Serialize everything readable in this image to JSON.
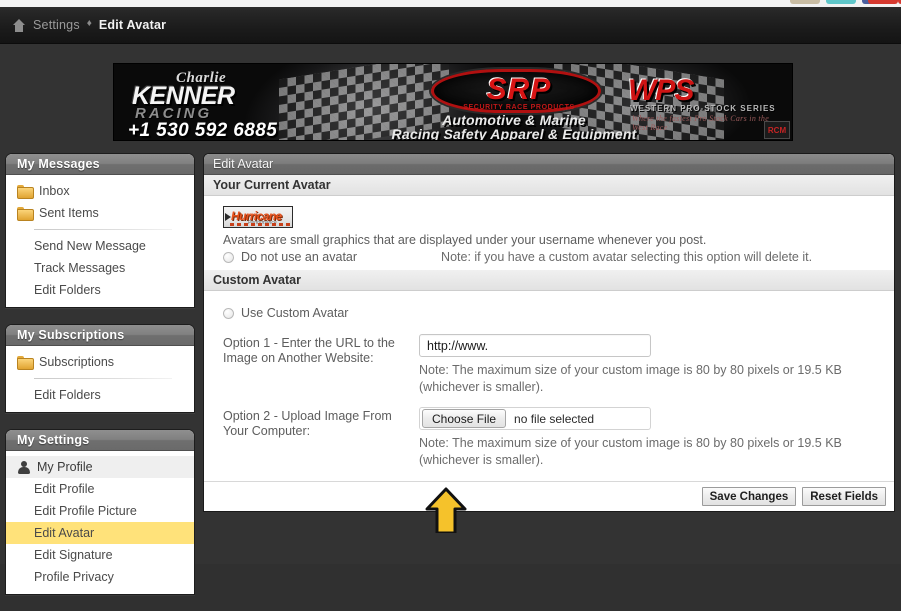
{
  "breadcrumb": {
    "home_icon": "home-icon",
    "parent": "Settings",
    "separator": "♦",
    "current": "Edit Avatar"
  },
  "banner": {
    "kenner": {
      "script": "Charlie",
      "main": "KENNER",
      "racing": "RACING",
      "phone": "+1 530 592 6885"
    },
    "srp": {
      "acronym": "SRP",
      "sub": "SECURITY RACE PRODUCTS",
      "line1": "Automotive & Marine",
      "line2": "Racing Safety Apparel & Equipment"
    },
    "wps": {
      "acronym": "WPS",
      "sub": "WESTERN PRO-STOCK SERIES",
      "sub2": "Where the fastest Pro Stock Cars in the West Race",
      "badge": "RCM"
    }
  },
  "sidebar": {
    "panels": [
      {
        "title": "My Messages",
        "items": [
          {
            "label": "Inbox",
            "icon": "folder-icon",
            "type": "folder"
          },
          {
            "label": "Sent Items",
            "icon": "folder-icon",
            "type": "folder"
          },
          {
            "label": "divider",
            "type": "divider"
          },
          {
            "label": "Send New Message",
            "type": "sub"
          },
          {
            "label": "Track Messages",
            "type": "sub"
          },
          {
            "label": "Edit Folders",
            "type": "sub"
          }
        ]
      },
      {
        "title": "My Subscriptions",
        "items": [
          {
            "label": "Subscriptions",
            "icon": "folder-icon",
            "type": "folder"
          },
          {
            "label": "divider",
            "type": "divider"
          },
          {
            "label": "Edit Folders",
            "type": "sub"
          }
        ]
      },
      {
        "title": "My Settings",
        "items": [
          {
            "label": "My Profile",
            "icon": "person-icon",
            "type": "person",
            "state": "current"
          },
          {
            "label": "Edit Profile",
            "type": "sub"
          },
          {
            "label": "Edit Profile Picture",
            "type": "sub"
          },
          {
            "label": "Edit Avatar",
            "type": "sub",
            "state": "active"
          },
          {
            "label": "Edit Signature",
            "type": "sub"
          },
          {
            "label": "Profile Privacy",
            "type": "sub"
          }
        ]
      }
    ]
  },
  "content": {
    "title": "Edit Avatar",
    "current_avatar": {
      "section_title": "Your Current Avatar",
      "thumb_logo_text": "Hurricane",
      "thumb_logo_sub": "Performance",
      "description": "Avatars are small graphics that are displayed under your username whenever you post.",
      "radio_label": "Do not use an avatar",
      "radio_note": "Note: if you have a custom avatar selecting this option will delete it."
    },
    "custom_avatar": {
      "section_title": "Custom Avatar",
      "use_custom_label": "Use Custom Avatar",
      "option1": {
        "label": "Option 1 - Enter the URL to the Image on Another Website:",
        "value": "http://www.",
        "note": "Note: The maximum size of your custom image is 80 by 80 pixels or 19.5 KB (whichever is smaller)."
      },
      "option2": {
        "label": "Option 2 - Upload Image From Your Computer:",
        "button": "Choose File",
        "status": "no file selected",
        "note": "Note: The maximum size of your custom image is 80 by 80 pixels or 19.5 KB (whichever is smaller)."
      }
    },
    "buttons": {
      "save": "Save Changes",
      "reset": "Reset Fields"
    }
  },
  "annotation": {
    "arrow_color": "#F5C22B",
    "arrow_outline": "#111111"
  },
  "colors": {
    "page_background": "#333333",
    "breadcrumb_background": "#1c1c1c",
    "panel_header": "#7a7a7a",
    "active_item": "#ffe27a",
    "accent_red": "#cf1414"
  }
}
